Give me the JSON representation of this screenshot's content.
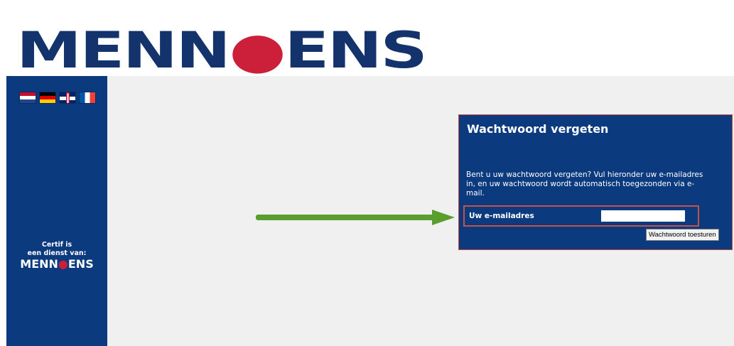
{
  "header": {
    "logo_part1": "MENN",
    "logo_part2": "ENS",
    "logo_colors": {
      "primary": "#14336d",
      "accent": "#cc1f3a"
    }
  },
  "sidebar": {
    "flags": [
      {
        "name": "dutch-flag-icon"
      },
      {
        "name": "german-flag-icon"
      },
      {
        "name": "english-flag-icon"
      },
      {
        "name": "french-flag-icon"
      }
    ],
    "certif_line1": "Certif is",
    "certif_line2": "een dienst van:",
    "certif_logo_part1": "MENN",
    "certif_logo_part2": "ENS",
    "background": "#0b3a7e"
  },
  "panel": {
    "title": "Wachtwoord vergeten",
    "description": "Bent u uw wachtwoord vergeten? Vul hieronder uw e-mailadres in, en uw wachtwoord wordt automatisch toegezonden via e-mail.",
    "email_label": "Uw e-mailadres",
    "email_value": "",
    "submit_label": "Wachtwoord toesturen",
    "highlight_color": "#c8504a"
  },
  "annotation": {
    "arrow_color": "#5a9f2e",
    "arrow_icon": "green-arrow-right-icon"
  }
}
